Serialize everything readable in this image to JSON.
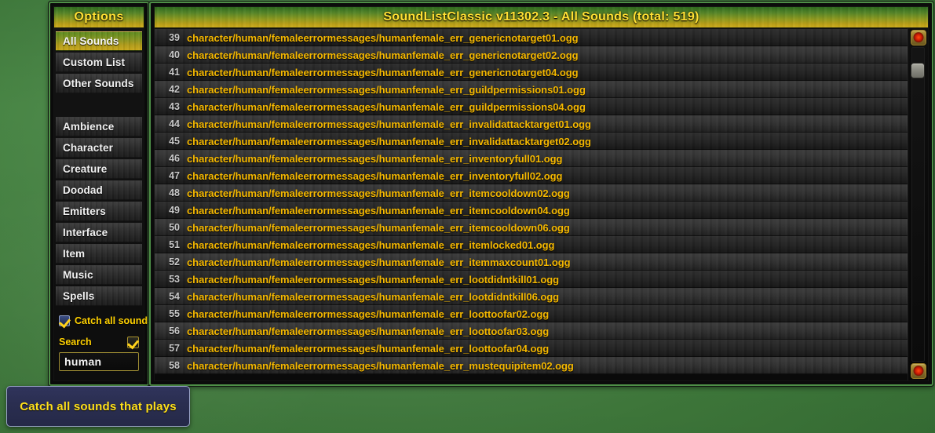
{
  "options_panel": {
    "title": "Options",
    "primary_items": [
      {
        "label": "All Sounds",
        "selected": true
      },
      {
        "label": "Custom List",
        "selected": false
      },
      {
        "label": "Other Sounds",
        "selected": false
      }
    ],
    "category_items": [
      {
        "label": "Ambience"
      },
      {
        "label": "Character"
      },
      {
        "label": "Creature"
      },
      {
        "label": "Doodad"
      },
      {
        "label": "Emitters"
      },
      {
        "label": "Interface"
      },
      {
        "label": "Item"
      },
      {
        "label": "Music"
      },
      {
        "label": "Spells"
      }
    ],
    "catch_all": {
      "label": "Catch all sounds",
      "checked": true,
      "icon": "checkbox-checked-icon"
    },
    "search": {
      "label": "Search",
      "toggle_icon": "checkmark-icon",
      "toggle_checked": true,
      "value": "human",
      "placeholder": "Search"
    }
  },
  "list_panel": {
    "title": "SoundListClassic v11302.3 - All Sounds (total: 519)",
    "rows": [
      {
        "index": "39",
        "path": "character/human/femaleerrormessages/humanfemale_err_genericnotarget01.ogg"
      },
      {
        "index": "40",
        "path": "character/human/femaleerrormessages/humanfemale_err_genericnotarget02.ogg"
      },
      {
        "index": "41",
        "path": "character/human/femaleerrormessages/humanfemale_err_genericnotarget04.ogg"
      },
      {
        "index": "42",
        "path": "character/human/femaleerrormessages/humanfemale_err_guildpermissions01.ogg"
      },
      {
        "index": "43",
        "path": "character/human/femaleerrormessages/humanfemale_err_guildpermissions04.ogg"
      },
      {
        "index": "44",
        "path": "character/human/femaleerrormessages/humanfemale_err_invalidattacktarget01.ogg"
      },
      {
        "index": "45",
        "path": "character/human/femaleerrormessages/humanfemale_err_invalidattacktarget02.ogg"
      },
      {
        "index": "46",
        "path": "character/human/femaleerrormessages/humanfemale_err_inventoryfull01.ogg"
      },
      {
        "index": "47",
        "path": "character/human/femaleerrormessages/humanfemale_err_inventoryfull02.ogg"
      },
      {
        "index": "48",
        "path": "character/human/femaleerrormessages/humanfemale_err_itemcooldown02.ogg"
      },
      {
        "index": "49",
        "path": "character/human/femaleerrormessages/humanfemale_err_itemcooldown04.ogg"
      },
      {
        "index": "50",
        "path": "character/human/femaleerrormessages/humanfemale_err_itemcooldown06.ogg"
      },
      {
        "index": "51",
        "path": "character/human/femaleerrormessages/humanfemale_err_itemlocked01.ogg"
      },
      {
        "index": "52",
        "path": "character/human/femaleerrormessages/humanfemale_err_itemmaxcount01.ogg"
      },
      {
        "index": "53",
        "path": "character/human/femaleerrormessages/humanfemale_err_lootdidntkill01.ogg"
      },
      {
        "index": "54",
        "path": "character/human/femaleerrormessages/humanfemale_err_lootdidntkill06.ogg"
      },
      {
        "index": "55",
        "path": "character/human/femaleerrormessages/humanfemale_err_loottoofar02.ogg"
      },
      {
        "index": "56",
        "path": "character/human/femaleerrormessages/humanfemale_err_loottoofar03.ogg"
      },
      {
        "index": "57",
        "path": "character/human/femaleerrormessages/humanfemale_err_loottoofar04.ogg"
      },
      {
        "index": "58",
        "path": "character/human/femaleerrormessages/humanfemale_err_mustequipitem02.ogg"
      }
    ],
    "scrollbar": {
      "up_icon": "scroll-up-gem-icon",
      "down_icon": "scroll-down-gem-icon"
    }
  },
  "tooltip": {
    "text": "Catch all sounds that plays"
  },
  "colors": {
    "accent_gold": "#f5b800",
    "title_text": "#ffe033",
    "frame_border": "#4e8f47",
    "background_green": "#4f8a4c",
    "tooltip_bg": "#2a2e50",
    "tooltip_text": "#ffe01a"
  }
}
